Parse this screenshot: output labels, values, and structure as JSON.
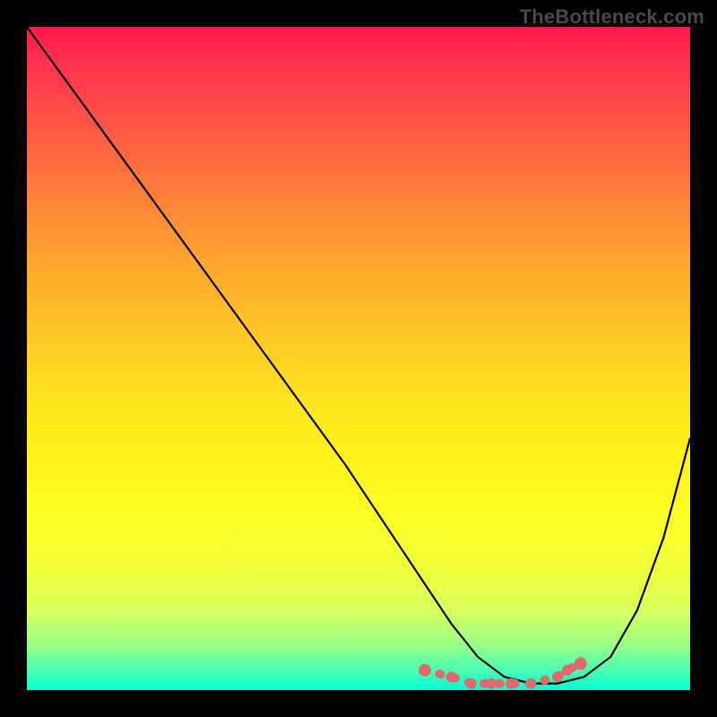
{
  "watermark": "TheBottleneck.com",
  "chart_data": {
    "type": "line",
    "title": "",
    "xlabel": "",
    "ylabel": "",
    "xlim": [
      0,
      100
    ],
    "ylim": [
      0,
      100
    ],
    "series": [
      {
        "name": "bottleneck-curve",
        "x": [
          0,
          8,
          16,
          24,
          32,
          40,
          48,
          56,
          60,
          64,
          68,
          72,
          76,
          80,
          84,
          88,
          92,
          96,
          100
        ],
        "values": [
          100,
          89,
          78,
          67,
          56,
          45,
          34,
          22,
          16,
          10,
          5,
          2,
          1,
          1,
          2,
          5,
          12,
          23,
          38
        ]
      }
    ],
    "markers": {
      "name": "highlight-dots",
      "color": "#e06a6a",
      "x": [
        60,
        64,
        67,
        70,
        73,
        76,
        80,
        81.5,
        83.5
      ],
      "values": [
        3,
        2,
        1,
        1,
        1,
        1,
        2,
        3,
        4
      ]
    },
    "gradient_stops": [
      {
        "pos": 0,
        "color": "#ff1a4d"
      },
      {
        "pos": 14,
        "color": "#ff5245"
      },
      {
        "pos": 34,
        "color": "#ffa030"
      },
      {
        "pos": 56,
        "color": "#ffe31e"
      },
      {
        "pos": 82,
        "color": "#f0ff3a"
      },
      {
        "pos": 97,
        "color": "#4affb3"
      },
      {
        "pos": 100,
        "color": "#00ffd6"
      }
    ]
  }
}
